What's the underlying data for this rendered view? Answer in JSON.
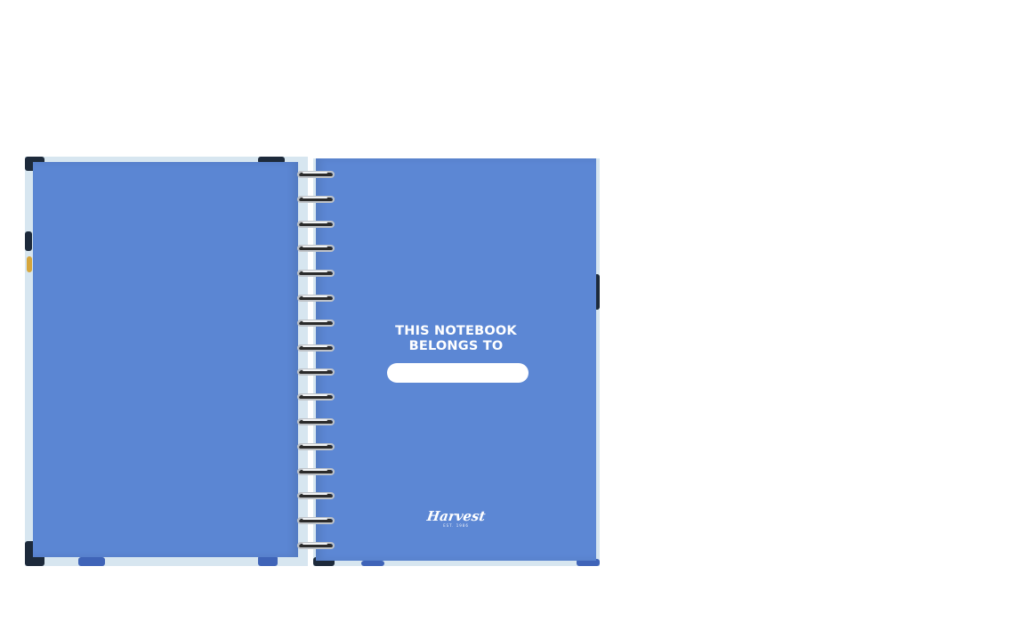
{
  "notebook": {
    "ownership_label": "THIS NOTEBOOK\nBELONGS TO",
    "ownership_line1": "THIS NOTEBOOK",
    "ownership_line2": "BELONGS TO",
    "brand_name": "Harvest",
    "brand_tagline": "EST. 1986",
    "page_color": "#5c87d4",
    "field_color": "#ffffff",
    "coil_count": 16
  }
}
